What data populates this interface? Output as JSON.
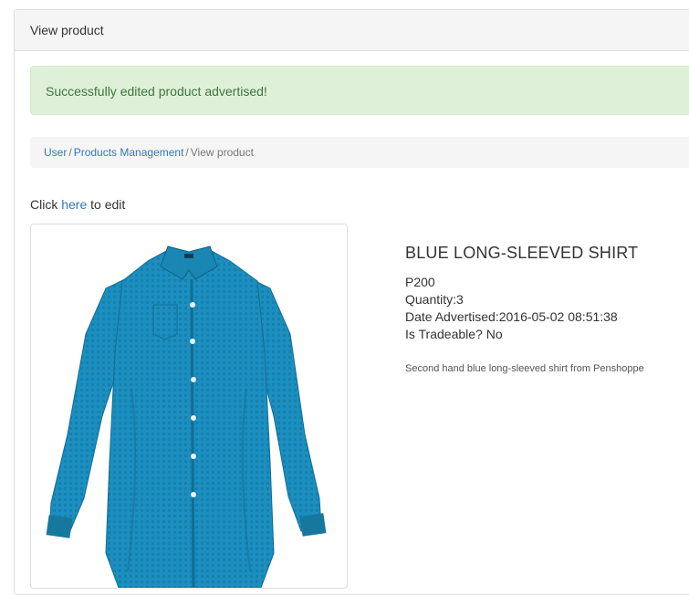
{
  "panel": {
    "title": "View product"
  },
  "alert": {
    "message": "Successfully edited product advertised!"
  },
  "breadcrumb": {
    "items": [
      {
        "label": "User"
      },
      {
        "label": "Products Management"
      },
      {
        "label": "View product"
      }
    ],
    "separator": "/"
  },
  "edit_prompt": {
    "prefix": "Click ",
    "link": "here",
    "suffix": " to edit"
  },
  "product": {
    "image_icon": "shirt-image",
    "name": "BLUE LONG-SLEEVED SHIRT",
    "price": "P200",
    "quantity": "Quantity:3",
    "date_advertised": "Date Advertised:2016-05-02 08:51:38",
    "tradeable": "Is Tradeable? No",
    "description": "Second hand blue long-sleeved shirt from Penshoppe"
  },
  "colors": {
    "shirt": "#1b8fc0",
    "link": "#337ab7",
    "alert_bg": "#dff0d8",
    "alert_text": "#3c763d"
  }
}
